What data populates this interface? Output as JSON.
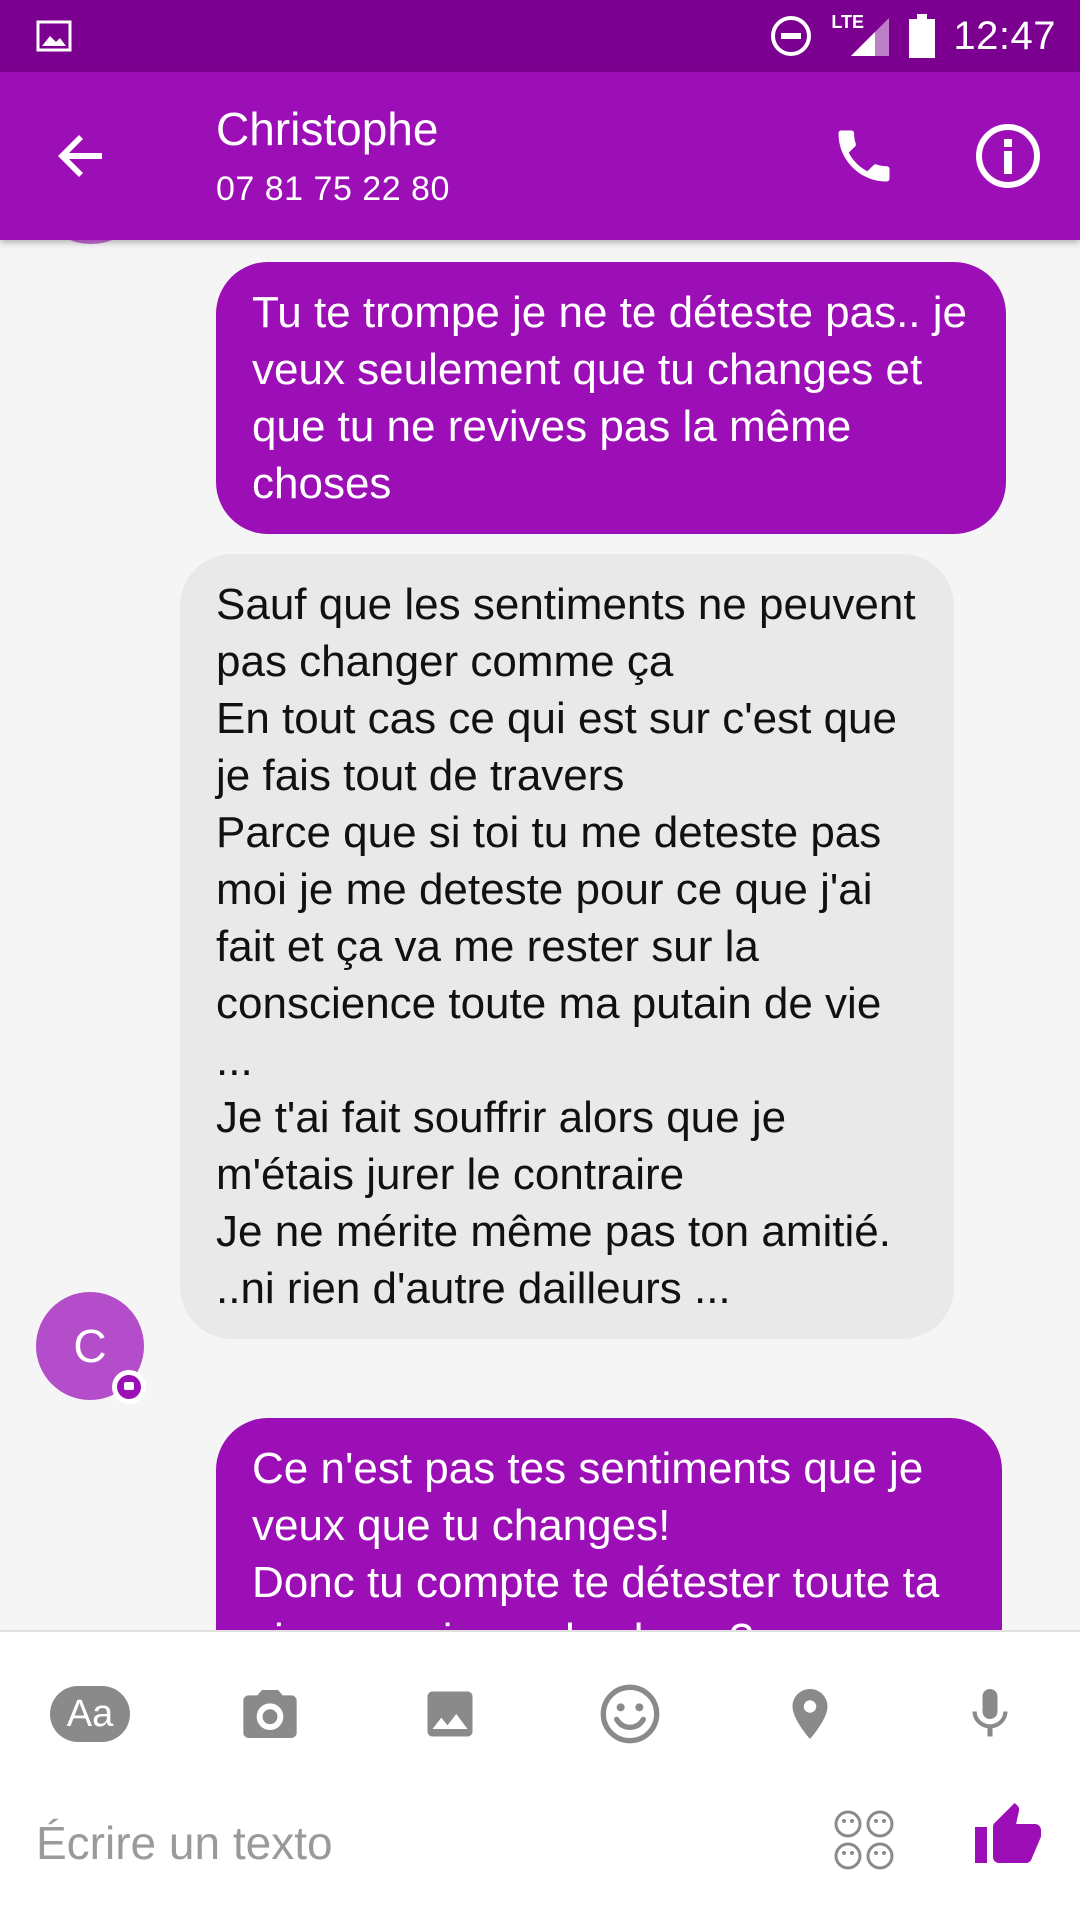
{
  "status_bar": {
    "time": "12:47",
    "network_label": "LTE",
    "icons": [
      "gallery-icon",
      "dnd-icon",
      "signal-icon",
      "battery-icon"
    ]
  },
  "app_bar": {
    "contact_name": "Christophe",
    "contact_phone": "07 81 75 22 80",
    "icons": [
      "back-arrow-icon",
      "phone-icon",
      "info-icon"
    ]
  },
  "colors": {
    "accent": "#9c0fb7",
    "status_bar": "#7b0090",
    "incoming_bubble": "#e9e9e9"
  },
  "messages": [
    {
      "direction": "outgoing",
      "text": "Tu te trompe je ne te déteste pas.. je veux seulement que tu changes et que tu ne revives pas la même choses"
    },
    {
      "direction": "incoming",
      "text": "Sauf que les sentiments ne peuvent pas changer comme ça\nEn tout cas ce qui est sur c'est que je fais tout de travers\nParce que si toi tu me deteste pas moi je me deteste pour ce que j'ai fait et ça va me rester sur la conscience toute ma putain de vie ...\nJe t'ai fait souffrir alors que je m'étais jurer le contraire\nJe ne mérite même pas ton amitié. ..ni rien d'autre dailleurs ..."
    },
    {
      "direction": "outgoing",
      "text": "Ce n'est pas tes sentiments que je veux que tu changes!\nDonc tu compte te détester toute ta vie pour si peu de chose?"
    }
  ],
  "avatar": {
    "initial": "C"
  },
  "composer": {
    "aa_label": "Aa",
    "placeholder": "Écrire un texto",
    "toolbar_icons": [
      "text-format-icon",
      "camera-icon",
      "image-icon",
      "emoji-icon",
      "location-icon",
      "microphone-icon"
    ]
  }
}
